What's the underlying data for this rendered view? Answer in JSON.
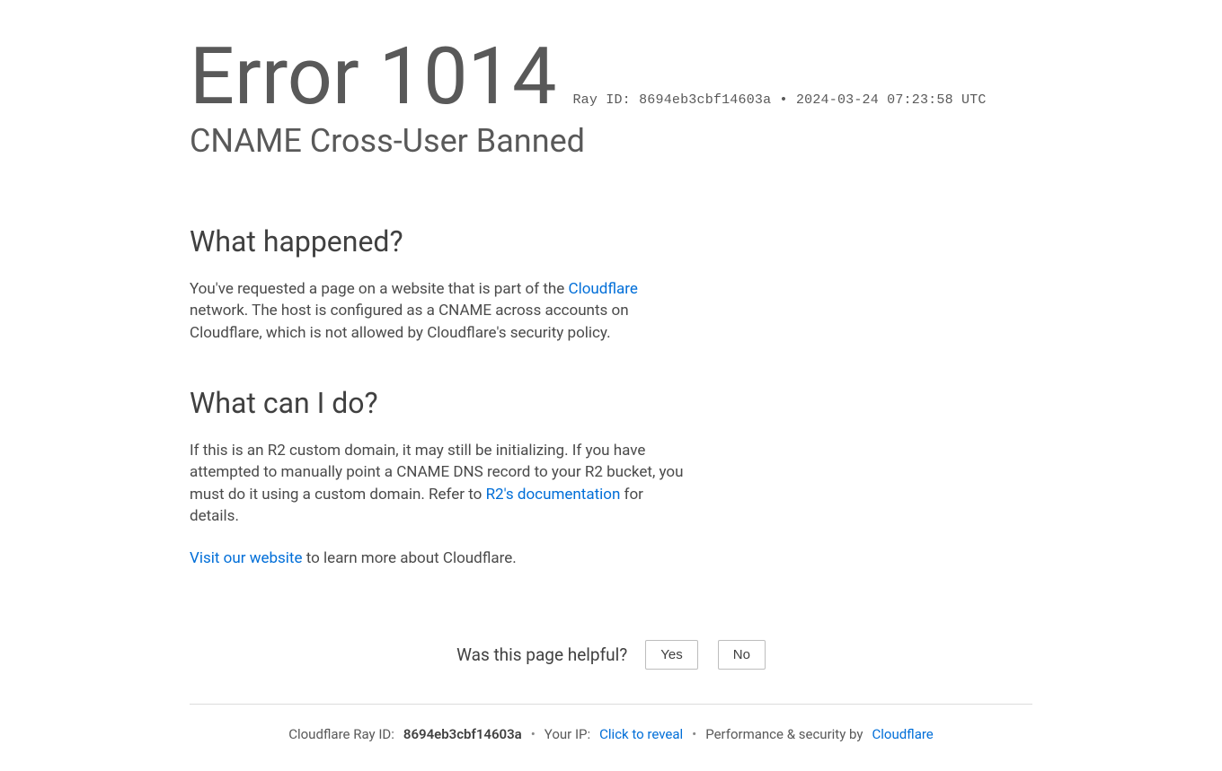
{
  "header": {
    "error_word": "Error",
    "error_code": "1014",
    "ray_prefix": "Ray ID:",
    "ray_id": "8694eb3cbf14603a",
    "bullet": "•",
    "timestamp": "2024-03-24 07:23:58 UTC",
    "subtitle": "CNAME Cross-User Banned"
  },
  "sections": {
    "what_happened": {
      "title": "What happened?",
      "text_before": "You've requested a page on a website that is part of the ",
      "link_text": "Cloudflare",
      "text_after": " network. The host is configured as a CNAME across accounts on Cloudflare, which is not allowed by Cloudflare's security policy."
    },
    "what_can_i_do": {
      "title": "What can I do?",
      "p1_before": "If this is an R2 custom domain, it may still be initializing. If you have attempted to manually point a CNAME DNS record to your R2 bucket, you must do it using a custom domain. Refer to ",
      "p1_link": "R2's documentation",
      "p1_after": " for details.",
      "p2_link": "Visit our website",
      "p2_after": " to learn more about Cloudflare."
    }
  },
  "feedback": {
    "question": "Was this page helpful?",
    "yes": "Yes",
    "no": "No"
  },
  "footer": {
    "cf_ray_label": "Cloudflare Ray ID:",
    "cf_ray_id": "8694eb3cbf14603a",
    "ip_label": "Your IP:",
    "ip_action": "Click to reveal",
    "perf_label": "Performance & security by",
    "perf_link": "Cloudflare"
  }
}
